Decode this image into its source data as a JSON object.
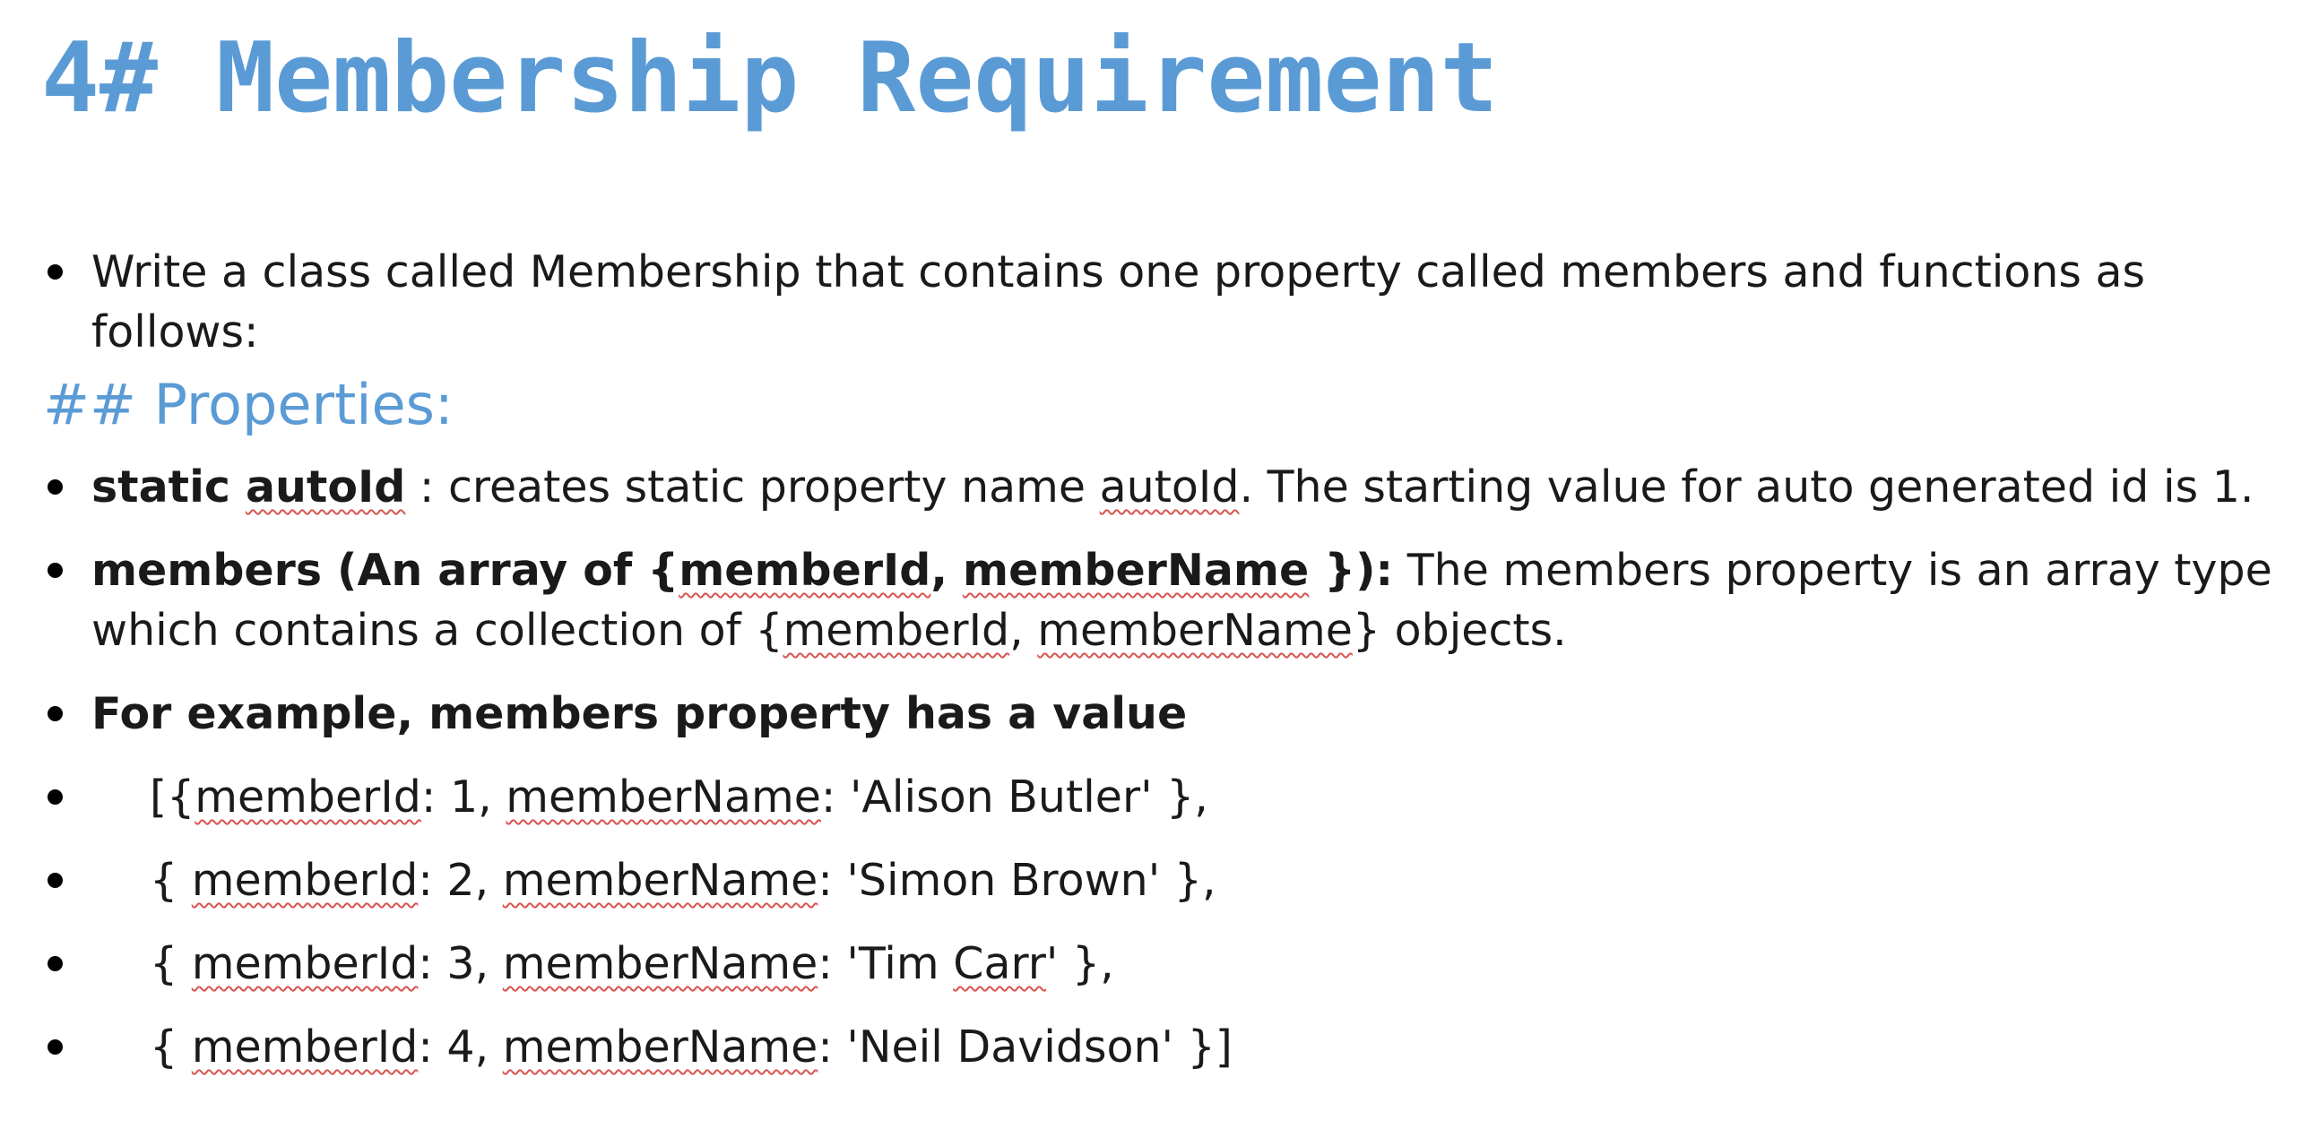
{
  "title": "4# Membership Requirement",
  "intro": "Write a class called Membership that contains one property called members and functions as follows:",
  "properties_heading": "## Properties:",
  "autoid": {
    "bold_prefix": "static ",
    "bold_word": "autoId",
    "text_1": " : creates static property name ",
    "word": "autoId",
    "text_2": ". The starting value for auto generated id is 1."
  },
  "members": {
    "bold_1": "members (An array of {",
    "bold_w1": "memberId",
    "bold_2": ", ",
    "bold_w2": "memberName",
    "bold_3": " }):",
    "text_1": " The members property is an array type which contains a collection of {",
    "w1": "memberId",
    "text_2": ", ",
    "w2": "memberName",
    "text_3": "} objects."
  },
  "example_intro": "For example, members property has a value",
  "example_rows": [
    {
      "open": "[{",
      "key1": "memberId",
      "mid1": ": 1, ",
      "key2": "memberName",
      "mid2": ": 'Alison Butler' },"
    },
    {
      "open": "{ ",
      "key1": "memberId",
      "mid1": ": 2, ",
      "key2": "memberName",
      "mid2": ": 'Simon Brown' },"
    },
    {
      "open": "{ ",
      "key1": "memberId",
      "mid1": ": 3, ",
      "key2": "memberName",
      "mid2": ": 'Tim ",
      "carr": "Carr",
      "mid3": "' },"
    },
    {
      "open": "{ ",
      "key1": "memberId",
      "mid1": ": 4, ",
      "key2": "memberName",
      "mid2": ": 'Neil Davidson' }]"
    }
  ]
}
